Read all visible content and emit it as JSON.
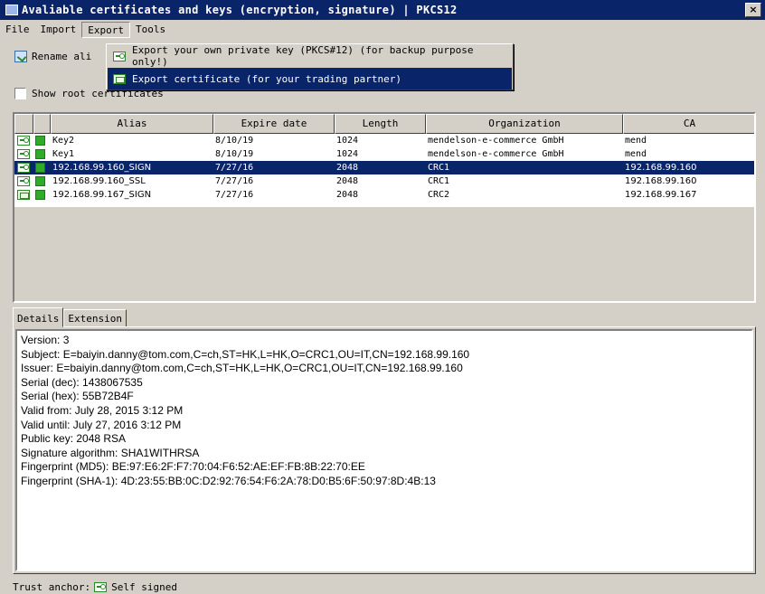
{
  "window": {
    "title": "Avaliable certificates and keys (encryption, signature) | PKCS12",
    "close_label": "×"
  },
  "menubar": {
    "items": [
      "File",
      "Import",
      "Export",
      "Tools"
    ]
  },
  "toolbar": {
    "rename_label": "Rename ali"
  },
  "export_menu": {
    "items": [
      {
        "label": "Export your own private key (PKCS#12) (for backup purpose only!)",
        "icon": "key-icon"
      },
      {
        "label": "Export certificate (for your trading partner)",
        "icon": "certificate-icon"
      }
    ]
  },
  "show_root": {
    "label": "Show root certificates",
    "checked": false
  },
  "table": {
    "columns": [
      "Alias",
      "Expire date",
      "Length",
      "Organization",
      "CA"
    ],
    "rows": [
      {
        "type": "key",
        "alias": "Key2",
        "expire": "8/10/19",
        "length": "1024",
        "organization": "mendelson-e-commerce GmbH",
        "ca": "mend"
      },
      {
        "type": "key",
        "alias": "Key1",
        "expire": "8/10/19",
        "length": "1024",
        "organization": "mendelson-e-commerce GmbH",
        "ca": "mend"
      },
      {
        "type": "key",
        "alias": "192.168.99.160_SIGN",
        "expire": "7/27/16",
        "length": "2048",
        "organization": "CRC1",
        "ca": "192.168.99.160"
      },
      {
        "type": "key",
        "alias": "192.168.99.160_SSL",
        "expire": "7/27/16",
        "length": "2048",
        "organization": "CRC1",
        "ca": "192.168.99.160"
      },
      {
        "type": "certificate",
        "alias": "192.168.99.167_SIGN",
        "expire": "7/27/16",
        "length": "2048",
        "organization": "CRC2",
        "ca": "192.168.99.167"
      }
    ],
    "selected_index": 2
  },
  "tabs": {
    "items": [
      "Details",
      "Extension"
    ],
    "active": 0
  },
  "details": {
    "lines": [
      "Version: 3",
      "Subject: E=baiyin.danny@tom.com,C=ch,ST=HK,L=HK,O=CRC1,OU=IT,CN=192.168.99.160",
      "Issuer: E=baiyin.danny@tom.com,C=ch,ST=HK,L=HK,O=CRC1,OU=IT,CN=192.168.99.160",
      "Serial (dec): 1438067535",
      "Serial (hex): 55B72B4F",
      "Valid from: July 28, 2015 3:12 PM",
      "Valid until: July 27, 2016 3:12 PM",
      "Public key: 2048 RSA",
      "Signature algorithm: SHA1WITHRSA",
      "Fingerprint (MD5): BE:97:E6:2F:F7:70:04:F6:52:AE:EF:FB:8B:22:70:EE",
      "Fingerprint (SHA-1): 4D:23:55:BB:0C:D2:92:76:54:F6:2A:78:D0:B5:6F:50:97:8D:4B:13"
    ]
  },
  "status": {
    "label": "Trust anchor:",
    "value": "Self signed"
  }
}
